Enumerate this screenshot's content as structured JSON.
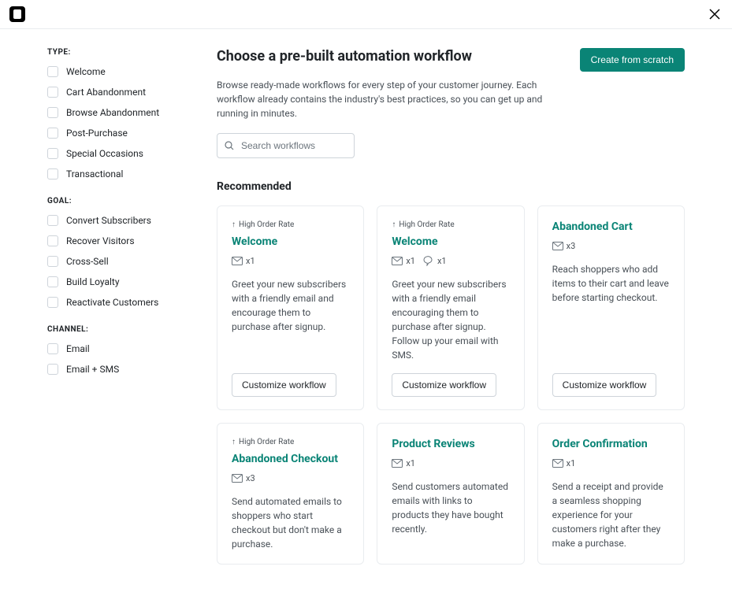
{
  "header": {
    "title": "Choose a pre-built automation workflow",
    "description": "Browse ready-made workflows for every step of your customer journey. Each workflow already contains the industry's best practices, so you can get up and running in minutes.",
    "create_button": "Create from scratch"
  },
  "search": {
    "placeholder": "Search workflows"
  },
  "sidebar": {
    "type_heading": "TYPE:",
    "type_items": [
      "Welcome",
      "Cart Abandonment",
      "Browse Abandonment",
      "Post-Purchase",
      "Special Occasions",
      "Transactional"
    ],
    "goal_heading": "GOAL:",
    "goal_items": [
      "Convert Subscribers",
      "Recover Visitors",
      "Cross-Sell",
      "Build Loyalty",
      "Reactivate Customers"
    ],
    "channel_heading": "CHANNEL:",
    "channel_items": [
      "Email",
      "Email + SMS"
    ]
  },
  "section": {
    "recommended": "Recommended"
  },
  "cards": [
    {
      "tag": "High Order Rate",
      "title": "Welcome",
      "channels": [
        {
          "type": "email",
          "count": "x1"
        }
      ],
      "desc": "Greet your new subscribers with a friendly email and encourage them to purchase after signup.",
      "button": "Customize workflow"
    },
    {
      "tag": "High Order Rate",
      "title": "Welcome",
      "channels": [
        {
          "type": "email",
          "count": "x1"
        },
        {
          "type": "sms",
          "count": "x1"
        }
      ],
      "desc": "Greet your new subscribers with a friendly email encouraging them to purchase after signup. Follow up your email with SMS.",
      "button": "Customize workflow"
    },
    {
      "tag": "",
      "title": "Abandoned Cart",
      "channels": [
        {
          "type": "email",
          "count": "x3"
        }
      ],
      "desc": "Reach shoppers who add items to their cart and leave before starting checkout.",
      "button": "Customize workflow"
    },
    {
      "tag": "High Order Rate",
      "title": "Abandoned Checkout",
      "channels": [
        {
          "type": "email",
          "count": "x3"
        }
      ],
      "desc": "Send automated emails to shoppers who start checkout but don't make a purchase.",
      "button": "Customize workflow"
    },
    {
      "tag": "",
      "title": "Product Reviews",
      "channels": [
        {
          "type": "email",
          "count": "x1"
        }
      ],
      "desc": "Send customers automated emails with links to products they have bought recently.",
      "button": "Customize workflow"
    },
    {
      "tag": "",
      "title": "Order Confirmation",
      "channels": [
        {
          "type": "email",
          "count": "x1"
        }
      ],
      "desc": "Send a receipt and provide a seamless shopping experience for your customers right after they make a purchase.",
      "button": "Customize workflow"
    }
  ]
}
